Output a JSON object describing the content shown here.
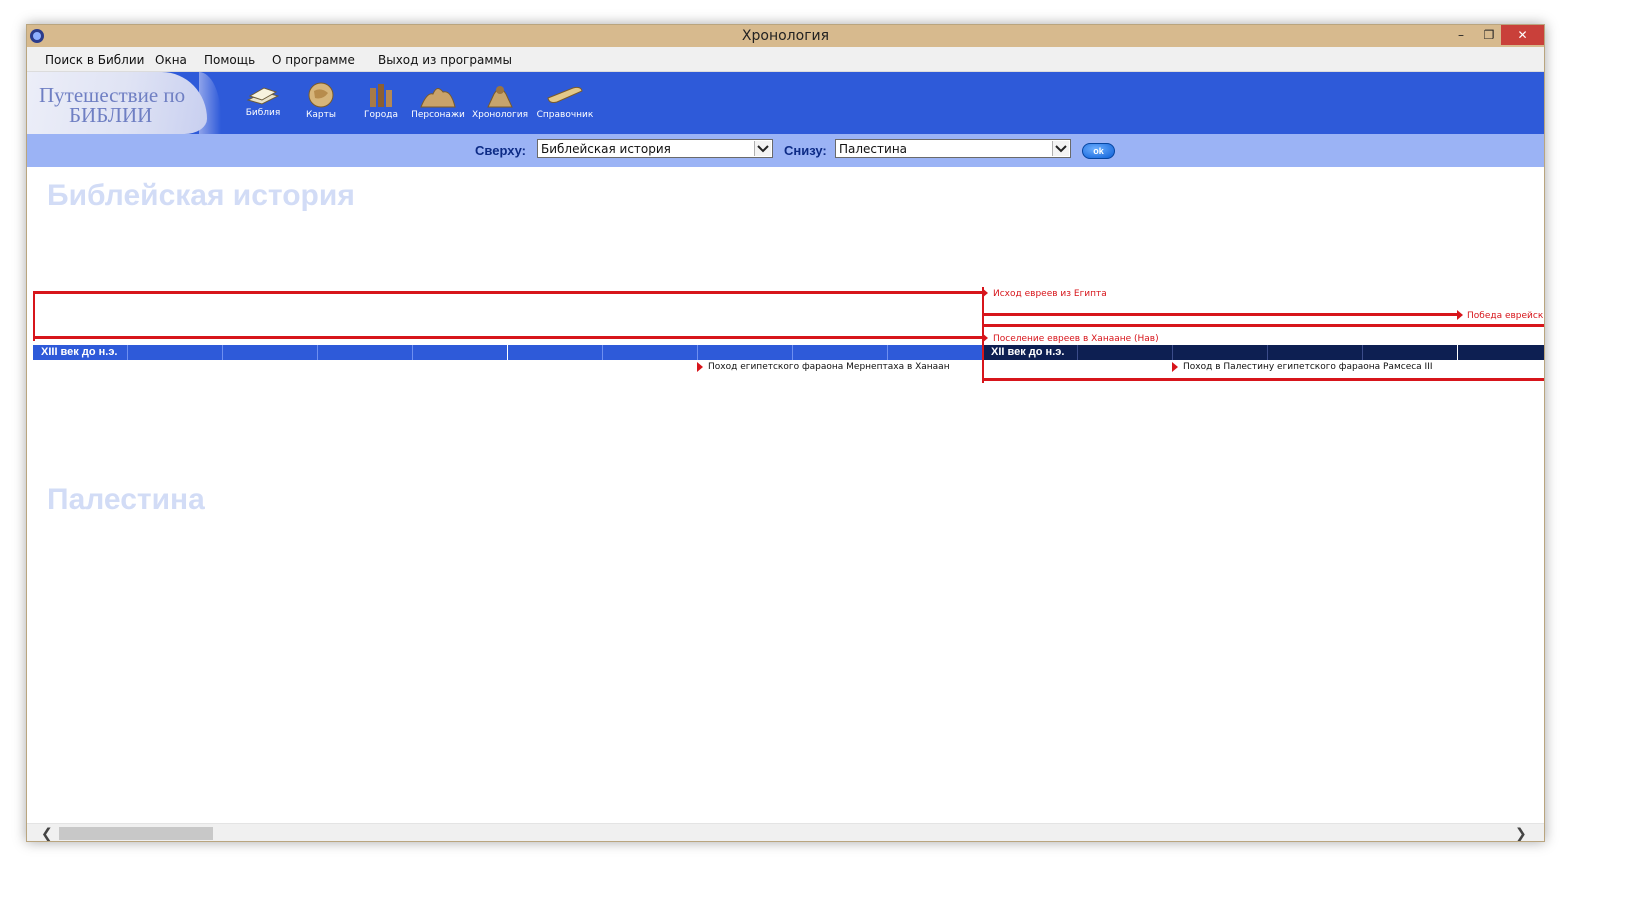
{
  "window": {
    "title": "Хронология",
    "controls": {
      "minimize": "–",
      "maximize": "❐",
      "close": "✕"
    }
  },
  "menu": {
    "items": [
      "Поиск в Библии",
      "Окна",
      "Помощь",
      "О программе",
      "Выход из программы"
    ]
  },
  "toolbar": {
    "logo": {
      "line1": "Путешествие по",
      "line2": "БИБЛИИ"
    },
    "tools": [
      {
        "label": "Библия",
        "icon": "book-icon"
      },
      {
        "label": "Карты",
        "icon": "map-icon"
      },
      {
        "label": "Города",
        "icon": "city-icon"
      },
      {
        "label": "Персонажи",
        "icon": "characters-icon"
      },
      {
        "label": "Хронология",
        "icon": "chronology-icon"
      },
      {
        "label": "Справочник",
        "icon": "scroll-icon"
      }
    ]
  },
  "filter": {
    "top_label": "Сверху:",
    "top_value": "Библейская история",
    "bottom_label": "Снизу:",
    "bottom_value": "Палестина",
    "ok_label": "ok"
  },
  "timeline": {
    "top_section_title": "Библейская история",
    "bottom_section_title": "Палестина",
    "centuries": [
      "XIII век до н.э.",
      "XII век до н.э."
    ],
    "events_above": [
      "Исход евреев из Египта",
      "Победа еврейск",
      "Поселение евреев в Ханаане (Нав)"
    ],
    "events_below": [
      "Поход египетского фараона Мернептаха в Ханаан",
      "Поход в Палестину египетского фараона Рамсеса III"
    ],
    "colors": {
      "event_line": "#d7151b",
      "century_bar": "#2e5ad9",
      "century_bar_dark": "#0d1f52"
    }
  }
}
